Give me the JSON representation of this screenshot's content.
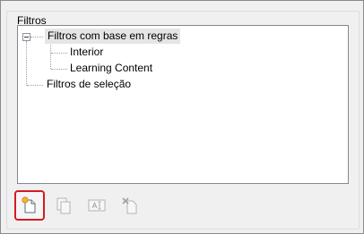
{
  "group": {
    "title": "Filtros"
  },
  "tree": {
    "root1": {
      "label": "Filtros com base em regras",
      "expanded": true,
      "selected": true
    },
    "children": [
      {
        "label": "Interior"
      },
      {
        "label": "Learning Content"
      }
    ],
    "root2": {
      "label": "Filtros de seleção"
    }
  },
  "toolbar": {
    "buttons": [
      {
        "name": "new-filter-icon",
        "enabled": true,
        "highlighted": true
      },
      {
        "name": "copy-filter-icon",
        "enabled": false
      },
      {
        "name": "rename-filter-icon",
        "enabled": false
      },
      {
        "name": "delete-filter-icon",
        "enabled": false
      }
    ],
    "highlight_color": "#d71920"
  }
}
